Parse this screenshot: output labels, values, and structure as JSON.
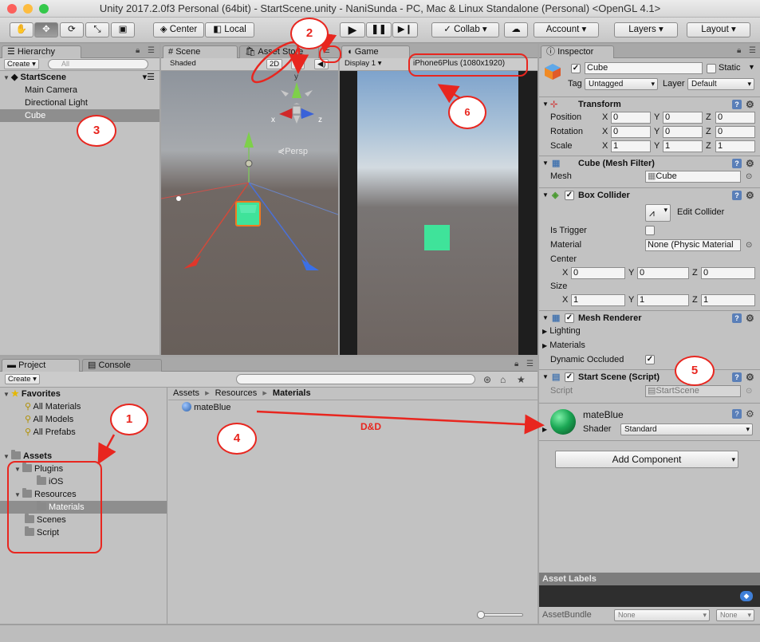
{
  "window": {
    "title": "Unity 2017.2.0f3 Personal (64bit) - StartScene.unity - NaniSunda - PC, Mac & Linux Standalone (Personal) <OpenGL 4.1>"
  },
  "toolbar": {
    "center": "Center",
    "local": "Local",
    "collab": "Collab",
    "account": "Account",
    "layers": "Layers",
    "layout": "Layout"
  },
  "hierarchy": {
    "tab": "Hierarchy",
    "create": "Create",
    "search_placeholder": "All",
    "scene": "StartScene",
    "items": [
      "Main Camera",
      "Directional Light",
      "Cube"
    ]
  },
  "scene": {
    "tab": "Scene",
    "tab2": "Asset Store",
    "shading": "Shaded",
    "mode2d": "2D",
    "persp": "Persp",
    "gizmo_y": "y",
    "gizmo_x": "x",
    "gizmo_z": "z"
  },
  "game": {
    "tab": "Game",
    "display": "Display 1",
    "resolution": "iPhone6Plus (1080x1920)"
  },
  "project": {
    "tab": "Project",
    "tab2": "Console",
    "create": "Create",
    "favorites": "Favorites",
    "fav_items": [
      "All Materials",
      "All Models",
      "All Prefabs"
    ],
    "assets": "Assets",
    "tree": [
      {
        "label": "Plugins"
      },
      {
        "label": "iOS"
      },
      {
        "label": "Resources"
      },
      {
        "label": "Materials"
      },
      {
        "label": "Scenes"
      },
      {
        "label": "Script"
      }
    ],
    "breadcrumb": [
      "Assets",
      "Resources",
      "Materials"
    ],
    "material": "mateBlue"
  },
  "inspector": {
    "tab": "Inspector",
    "name": "Cube",
    "static": "Static",
    "tag_label": "Tag",
    "tag": "Untagged",
    "layer_label": "Layer",
    "layer": "Default",
    "transform": {
      "title": "Transform",
      "position": {
        "label": "Position",
        "x": "0",
        "y": "0",
        "z": "0"
      },
      "rotation": {
        "label": "Rotation",
        "x": "0",
        "y": "0",
        "z": "0"
      },
      "scale": {
        "label": "Scale",
        "x": "1",
        "y": "1",
        "z": "1"
      }
    },
    "mesh_filter": {
      "title": "Cube (Mesh Filter)",
      "mesh_label": "Mesh",
      "mesh": "Cube"
    },
    "box_collider": {
      "title": "Box Collider",
      "edit": "Edit Collider",
      "is_trigger": "Is Trigger",
      "material_label": "Material",
      "material": "None (Physic Material",
      "center": "Center",
      "center_x": "0",
      "center_y": "0",
      "center_z": "0",
      "size": "Size",
      "size_x": "1",
      "size_y": "1",
      "size_z": "1"
    },
    "mesh_renderer": {
      "title": "Mesh Renderer",
      "lighting": "Lighting",
      "materials": "Materials",
      "dynamic_occluded": "Dynamic Occluded"
    },
    "start_scene": {
      "title": "Start Scene (Script)",
      "script_label": "Script",
      "script": "StartScene"
    },
    "material": {
      "name": "mateBlue",
      "shader_label": "Shader",
      "shader": "Standard"
    },
    "add_component": "Add Component",
    "asset_labels": "Asset Labels",
    "asset_bundle": "AssetBundle",
    "bundle_none1": "None",
    "bundle_none2": "None"
  },
  "axis_labels": {
    "x": "X",
    "y": "Y",
    "z": "Z"
  },
  "annotations": {
    "n1": "1",
    "n2": "2",
    "n3": "3",
    "n4": "4",
    "n5": "5",
    "n6": "6",
    "dnd": "D&D"
  },
  "colors": {
    "annotation": "#e8261f",
    "cube": "#3fe39a",
    "selection": "#8e8e8e"
  }
}
